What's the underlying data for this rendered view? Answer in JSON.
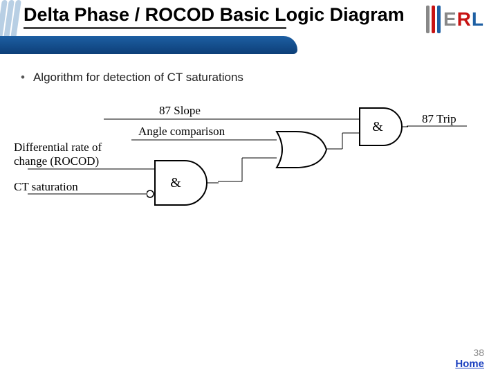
{
  "header": {
    "title": "Delta Phase / ROCOD Basic Logic Diagram",
    "logo_letters": {
      "E": "E",
      "R": "R",
      "L": "L"
    }
  },
  "body": {
    "bullet_marker": "•",
    "bullet_text": "Algorithm for detection of CT saturations"
  },
  "diagram": {
    "signals": {
      "slope": "87 Slope",
      "angle": "Angle comparison",
      "rocod_line1": "Differential rate of",
      "rocod_line2": "change (ROCOD)",
      "ctsat": "CT saturation",
      "trip": "87 Trip"
    },
    "gates": {
      "and1": "&",
      "or": "OR",
      "and2": "&"
    }
  },
  "chart_data": {
    "type": "diagram",
    "description": "Protection relay logic: AND of ROCOD and inverted CT-saturation feeds an OR with angle-comparison; the OR output ANDed with 87-Slope yields 87 Trip.",
    "nodes": [
      {
        "id": "slope",
        "label": "87 Slope",
        "kind": "input"
      },
      {
        "id": "angle",
        "label": "Angle comparison",
        "kind": "input"
      },
      {
        "id": "rocod",
        "label": "Differential rate of change (ROCOD)",
        "kind": "input"
      },
      {
        "id": "ctsat",
        "label": "CT saturation",
        "kind": "input"
      },
      {
        "id": "and1",
        "label": "&",
        "kind": "AND",
        "inverted_inputs": [
          "ctsat"
        ]
      },
      {
        "id": "or1",
        "label": "OR",
        "kind": "OR"
      },
      {
        "id": "and2",
        "label": "&",
        "kind": "AND"
      },
      {
        "id": "trip",
        "label": "87 Trip",
        "kind": "output"
      }
    ],
    "edges": [
      {
        "from": "rocod",
        "to": "and1"
      },
      {
        "from": "ctsat",
        "to": "and1"
      },
      {
        "from": "and1",
        "to": "or1"
      },
      {
        "from": "angle",
        "to": "or1"
      },
      {
        "from": "or1",
        "to": "and2"
      },
      {
        "from": "slope",
        "to": "and2"
      },
      {
        "from": "and2",
        "to": "trip"
      }
    ]
  },
  "footer": {
    "page": "38",
    "home": "Home"
  }
}
